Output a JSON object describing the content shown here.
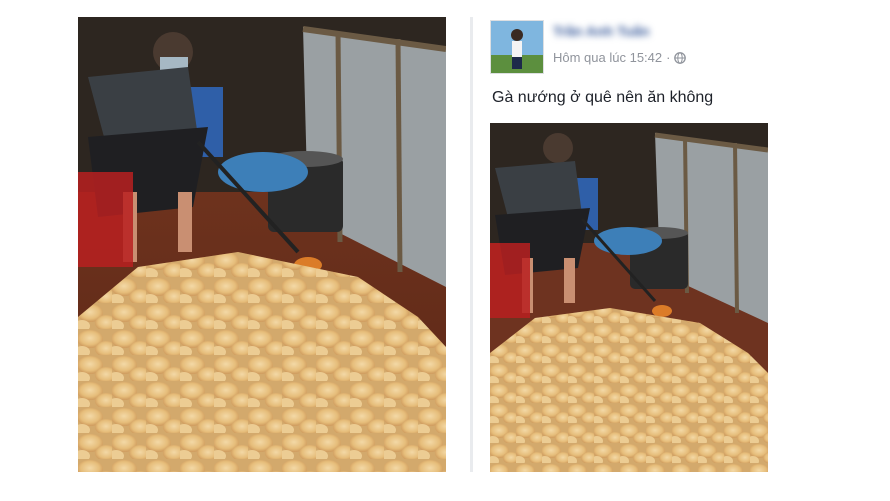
{
  "post": {
    "author_name": "Trần Anh Tuấn",
    "timestamp": "Hôm qua lúc 15:42",
    "separator": "·",
    "text": "Gà nướng ở quê nên ăn không"
  },
  "colors": {
    "link": "#365899",
    "meta": "#90949c",
    "text": "#1d2129",
    "divider": "#e9ebee"
  },
  "icons": {
    "privacy": "globe-icon"
  }
}
